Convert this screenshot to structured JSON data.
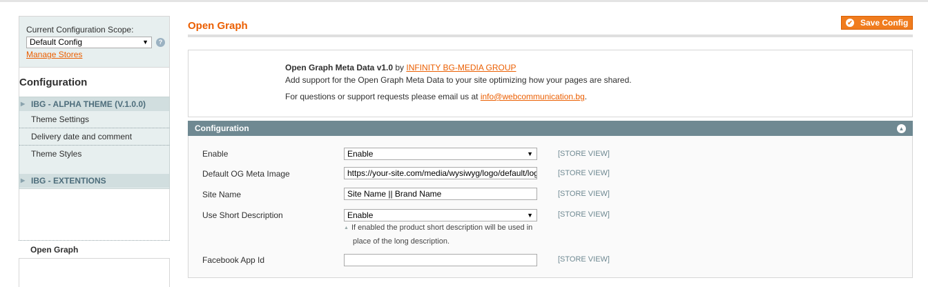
{
  "sidebar": {
    "scope_label": "Current Configuration Scope:",
    "scope_value": "Default Config",
    "manage_stores": "Manage Stores",
    "config_title": "Configuration",
    "groups": [
      {
        "label": "IBG - ALPHA THEME (V.1.0.0)",
        "items": [
          "Theme Settings",
          "Delivery date and comment",
          "Theme Styles"
        ]
      },
      {
        "label": "IBG - EXTENTIONS",
        "items": []
      }
    ],
    "active_item": "Open Graph"
  },
  "header": {
    "title": "Open Graph",
    "save_label": "Save Config"
  },
  "info": {
    "name": "Open Graph Meta Data v1.0",
    "by": " by ",
    "company": "INFINITY BG-MEDIA GROUP",
    "description": "Add support for the Open Graph Meta Data to your site optimizing how your pages are shared.",
    "support_text": "For questions or support requests please email us at ",
    "email": "info@webcommunication.bg",
    "period": "."
  },
  "section": {
    "title": "Configuration",
    "rows": [
      {
        "label": "Enable",
        "value": "Enable",
        "scope": "[STORE VIEW]"
      },
      {
        "label": "Default OG Meta Image",
        "value": "https://your-site.com/media/wysiwyg/logo/default/logo.png",
        "scope": "[STORE VIEW]"
      },
      {
        "label": "Site Name",
        "value": "Site Name || Brand Name",
        "scope": "[STORE VIEW]"
      },
      {
        "label": "Use Short Description",
        "value": "Enable",
        "scope": "[STORE VIEW]",
        "note_line1": "If enabled the product short description will be used in",
        "note_line2": "place of the long description."
      },
      {
        "label": "Facebook App Id",
        "value": "",
        "scope": "[STORE VIEW]"
      }
    ]
  },
  "colors": {
    "accent": "#eb5e00",
    "section_header": "#6f8992",
    "button": "#f07c1e"
  }
}
